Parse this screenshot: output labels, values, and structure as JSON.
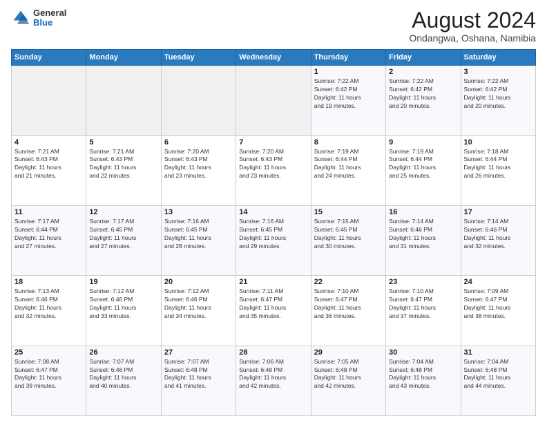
{
  "logo": {
    "general": "General",
    "blue": "Blue"
  },
  "header": {
    "month": "August 2024",
    "location": "Ondangwa, Oshana, Namibia"
  },
  "weekdays": [
    "Sunday",
    "Monday",
    "Tuesday",
    "Wednesday",
    "Thursday",
    "Friday",
    "Saturday"
  ],
  "weeks": [
    [
      {
        "day": "",
        "info": ""
      },
      {
        "day": "",
        "info": ""
      },
      {
        "day": "",
        "info": ""
      },
      {
        "day": "",
        "info": ""
      },
      {
        "day": "1",
        "info": "Sunrise: 7:22 AM\nSunset: 6:42 PM\nDaylight: 11 hours\nand 19 minutes."
      },
      {
        "day": "2",
        "info": "Sunrise: 7:22 AM\nSunset: 6:42 PM\nDaylight: 11 hours\nand 20 minutes."
      },
      {
        "day": "3",
        "info": "Sunrise: 7:22 AM\nSunset: 6:42 PM\nDaylight: 11 hours\nand 20 minutes."
      }
    ],
    [
      {
        "day": "4",
        "info": "Sunrise: 7:21 AM\nSunset: 6:43 PM\nDaylight: 11 hours\nand 21 minutes."
      },
      {
        "day": "5",
        "info": "Sunrise: 7:21 AM\nSunset: 6:43 PM\nDaylight: 11 hours\nand 22 minutes."
      },
      {
        "day": "6",
        "info": "Sunrise: 7:20 AM\nSunset: 6:43 PM\nDaylight: 11 hours\nand 23 minutes."
      },
      {
        "day": "7",
        "info": "Sunrise: 7:20 AM\nSunset: 6:43 PM\nDaylight: 11 hours\nand 23 minutes."
      },
      {
        "day": "8",
        "info": "Sunrise: 7:19 AM\nSunset: 6:44 PM\nDaylight: 11 hours\nand 24 minutes."
      },
      {
        "day": "9",
        "info": "Sunrise: 7:19 AM\nSunset: 6:44 PM\nDaylight: 11 hours\nand 25 minutes."
      },
      {
        "day": "10",
        "info": "Sunrise: 7:18 AM\nSunset: 6:44 PM\nDaylight: 11 hours\nand 26 minutes."
      }
    ],
    [
      {
        "day": "11",
        "info": "Sunrise: 7:17 AM\nSunset: 6:44 PM\nDaylight: 11 hours\nand 27 minutes."
      },
      {
        "day": "12",
        "info": "Sunrise: 7:17 AM\nSunset: 6:45 PM\nDaylight: 11 hours\nand 27 minutes."
      },
      {
        "day": "13",
        "info": "Sunrise: 7:16 AM\nSunset: 6:45 PM\nDaylight: 11 hours\nand 28 minutes."
      },
      {
        "day": "14",
        "info": "Sunrise: 7:16 AM\nSunset: 6:45 PM\nDaylight: 11 hours\nand 29 minutes."
      },
      {
        "day": "15",
        "info": "Sunrise: 7:15 AM\nSunset: 6:45 PM\nDaylight: 11 hours\nand 30 minutes."
      },
      {
        "day": "16",
        "info": "Sunrise: 7:14 AM\nSunset: 6:46 PM\nDaylight: 11 hours\nand 31 minutes."
      },
      {
        "day": "17",
        "info": "Sunrise: 7:14 AM\nSunset: 6:46 PM\nDaylight: 11 hours\nand 32 minutes."
      }
    ],
    [
      {
        "day": "18",
        "info": "Sunrise: 7:13 AM\nSunset: 6:46 PM\nDaylight: 11 hours\nand 32 minutes."
      },
      {
        "day": "19",
        "info": "Sunrise: 7:12 AM\nSunset: 6:46 PM\nDaylight: 11 hours\nand 33 minutes."
      },
      {
        "day": "20",
        "info": "Sunrise: 7:12 AM\nSunset: 6:46 PM\nDaylight: 11 hours\nand 34 minutes."
      },
      {
        "day": "21",
        "info": "Sunrise: 7:11 AM\nSunset: 6:47 PM\nDaylight: 11 hours\nand 35 minutes."
      },
      {
        "day": "22",
        "info": "Sunrise: 7:10 AM\nSunset: 6:47 PM\nDaylight: 11 hours\nand 36 minutes."
      },
      {
        "day": "23",
        "info": "Sunrise: 7:10 AM\nSunset: 6:47 PM\nDaylight: 11 hours\nand 37 minutes."
      },
      {
        "day": "24",
        "info": "Sunrise: 7:09 AM\nSunset: 6:47 PM\nDaylight: 11 hours\nand 38 minutes."
      }
    ],
    [
      {
        "day": "25",
        "info": "Sunrise: 7:08 AM\nSunset: 6:47 PM\nDaylight: 11 hours\nand 39 minutes."
      },
      {
        "day": "26",
        "info": "Sunrise: 7:07 AM\nSunset: 6:48 PM\nDaylight: 11 hours\nand 40 minutes."
      },
      {
        "day": "27",
        "info": "Sunrise: 7:07 AM\nSunset: 6:48 PM\nDaylight: 11 hours\nand 41 minutes."
      },
      {
        "day": "28",
        "info": "Sunrise: 7:06 AM\nSunset: 6:48 PM\nDaylight: 11 hours\nand 42 minutes."
      },
      {
        "day": "29",
        "info": "Sunrise: 7:05 AM\nSunset: 6:48 PM\nDaylight: 11 hours\nand 42 minutes."
      },
      {
        "day": "30",
        "info": "Sunrise: 7:04 AM\nSunset: 6:48 PM\nDaylight: 11 hours\nand 43 minutes."
      },
      {
        "day": "31",
        "info": "Sunrise: 7:04 AM\nSunset: 6:48 PM\nDaylight: 11 hours\nand 44 minutes."
      }
    ]
  ]
}
